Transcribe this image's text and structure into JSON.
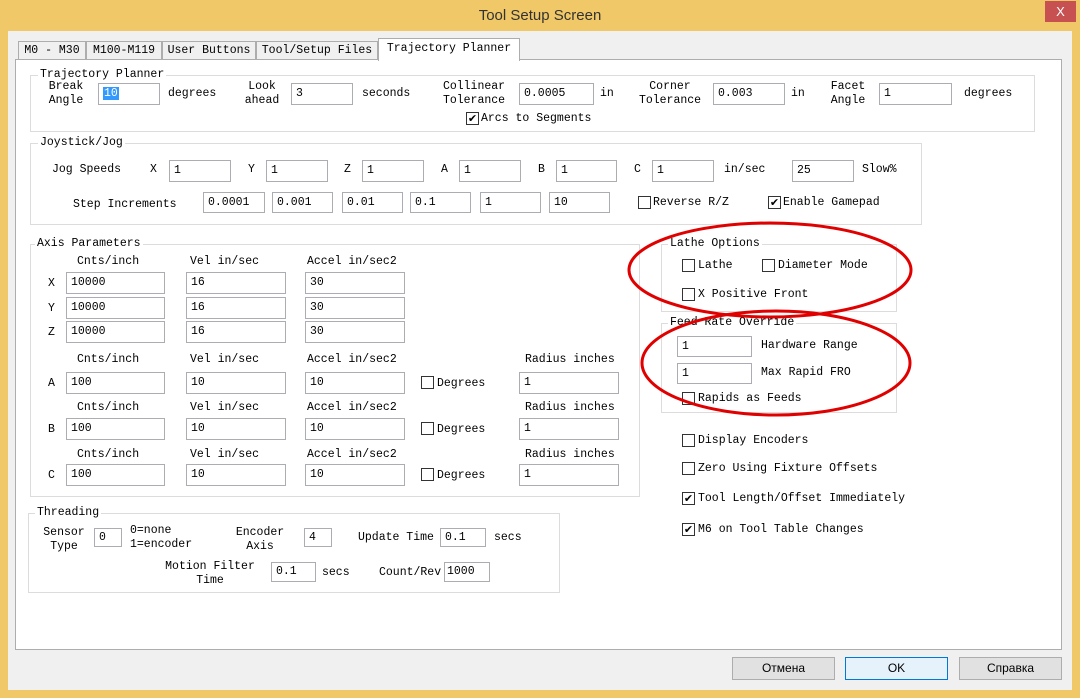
{
  "window": {
    "title": "Tool Setup Screen",
    "close": "X"
  },
  "tabs": [
    "M0 - M30",
    "M100-M119",
    "User Buttons",
    "Tool/Setup Files",
    "Trajectory Planner"
  ],
  "traj": {
    "group": "Trajectory Planner",
    "break_angle": [
      "Break",
      "Angle"
    ],
    "break_angle_value": "10",
    "degrees": "degrees",
    "look_ahead": [
      "Look",
      "ahead"
    ],
    "look_ahead_value": "3",
    "seconds": "seconds",
    "collinear": [
      "Collinear",
      "Tolerance"
    ],
    "collinear_value": "0.0005",
    "in": "in",
    "corner": [
      "Corner",
      "Tolerance"
    ],
    "corner_value": "0.003",
    "facet": [
      "Facet",
      "Angle"
    ],
    "facet_value": "1",
    "arcs": "Arcs to Segments",
    "arcs_checked": true
  },
  "jog": {
    "group": "Joystick/Jog",
    "jog_speeds": "Jog Speeds",
    "axes": [
      "X",
      "Y",
      "Z",
      "A",
      "B",
      "C"
    ],
    "speeds": [
      "1",
      "1",
      "1",
      "1",
      "1",
      "1"
    ],
    "in_sec": "in/sec",
    "slow_value": "25",
    "slow": "Slow%",
    "step_increments": "Step Increments",
    "steps": [
      "0.0001",
      "0.001",
      "0.01",
      "0.1",
      "1",
      "10"
    ],
    "reverse": "Reverse R/Z",
    "reverse_checked": false,
    "gamepad": "Enable Gamepad",
    "gamepad_checked": true
  },
  "axis": {
    "group": "Axis Parameters",
    "cnts": "Cnts/inch",
    "vel": "Vel in/sec",
    "accel": "Accel in/sec2",
    "radius": "Radius inches",
    "degrees": "Degrees",
    "linear": [
      {
        "axis": "X",
        "cnts": "10000",
        "vel": "16",
        "accel": "30"
      },
      {
        "axis": "Y",
        "cnts": "10000",
        "vel": "16",
        "accel": "30"
      },
      {
        "axis": "Z",
        "cnts": "10000",
        "vel": "16",
        "accel": "30"
      }
    ],
    "rotary": [
      {
        "axis": "A",
        "cnts": "100",
        "vel": "10",
        "accel": "10",
        "degrees": false,
        "radius": "1"
      },
      {
        "axis": "B",
        "cnts": "100",
        "vel": "10",
        "accel": "10",
        "degrees": false,
        "radius": "1"
      },
      {
        "axis": "C",
        "cnts": "100",
        "vel": "10",
        "accel": "10",
        "degrees": false,
        "radius": "1"
      }
    ]
  },
  "threading": {
    "group": "Threading",
    "sensor_type": [
      "Sensor",
      "Type"
    ],
    "sensor_value": "0",
    "sensor_help": [
      "0=none",
      "1=encoder"
    ],
    "encoder_axis": [
      "Encoder",
      "Axis"
    ],
    "encoder_value": "4",
    "update_time": "Update Time",
    "update_value": "0.1",
    "secs": "secs",
    "motion_filter": [
      "Motion Filter",
      "Time"
    ],
    "motion_value": "0.1",
    "count_rev": "Count/Rev",
    "count_value": "1000"
  },
  "lathe": {
    "group": "Lathe Options",
    "lathe": "Lathe",
    "diameter": "Diameter Mode",
    "x_positive": "X Positive Front"
  },
  "fro": {
    "group": "Feed Rate Override",
    "hw_value": "1",
    "hw": "Hardware Range",
    "max_value": "1",
    "max": "Max Rapid FRO",
    "rapids": "Rapids as Feeds"
  },
  "options": [
    {
      "label": "Display Encoders",
      "checked": false
    },
    {
      "label": "Zero Using Fixture Offsets",
      "checked": false
    },
    {
      "label": "Tool Length/Offset Immediately",
      "checked": true
    },
    {
      "label": "M6 on Tool Table Changes",
      "checked": true
    }
  ],
  "buttons": {
    "cancel": "Отмена",
    "ok": "OK",
    "help": "Справка"
  },
  "annotation_color": "#e00000"
}
